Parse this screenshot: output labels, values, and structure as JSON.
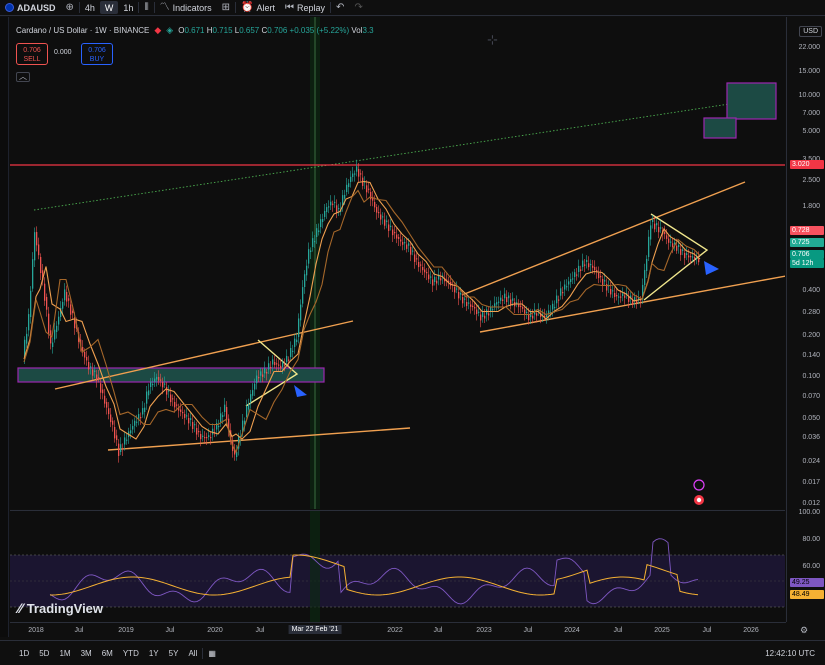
{
  "toolbar": {
    "symbol": "ADAUSD",
    "intervals": [
      "4h",
      "W",
      "1h"
    ],
    "active_interval": "W",
    "indicators_label": "Indicators",
    "alert_label": "Alert",
    "replay_label": "Replay"
  },
  "legend": {
    "title": "Cardano / US Dollar · 1W · BINANCE",
    "open_label": "O",
    "open": "0.671",
    "high_label": "H",
    "high": "0.715",
    "low_label": "L",
    "low": "0.657",
    "close_label": "C",
    "close": "0.706",
    "change": "+0.035 (+5.22%)",
    "vol_label": "Vol",
    "vol": "3.3"
  },
  "trade": {
    "sell_price": "0.706",
    "sell_label": "SELL",
    "spread": "0.000",
    "buy_price": "0.706",
    "buy_label": "BUY"
  },
  "price_axis": {
    "currency": "USD",
    "ticks": [
      "22.000",
      "15.000",
      "10.000",
      "7.000",
      "5.000",
      "3.500",
      "2.500",
      "1.800",
      "1.200",
      "0.400",
      "0.280",
      "0.200",
      "0.140",
      "0.100",
      "0.070",
      "0.050",
      "0.036",
      "0.024",
      "0.017",
      "0.012"
    ],
    "tags": [
      {
        "text": "3.020",
        "color": "#f23645"
      },
      {
        "text": "0.728",
        "color": "#f7525f"
      },
      {
        "text": "0.725",
        "color": "#22ab94"
      },
      {
        "text": "0.706",
        "color": "#089981"
      },
      {
        "text": "5d 12h",
        "color": "#089981"
      }
    ]
  },
  "rsi_axis": {
    "ticks": [
      "100.00",
      "80.00",
      "60.00"
    ],
    "tags": [
      {
        "text": "49.25",
        "color": "#7e57c2"
      },
      {
        "text": "48.49",
        "color": "#f5b133"
      }
    ]
  },
  "time_axis": {
    "ticks": [
      "2018",
      "Jul",
      "2019",
      "Jul",
      "2020",
      "Jul",
      "2022",
      "Jul",
      "2023",
      "Jul",
      "2024",
      "Jul",
      "2025",
      "Jul",
      "2026"
    ],
    "cursor_label": "Mar 22 Feb '21"
  },
  "brand": "TradingView",
  "bottom": {
    "ranges": [
      "1D",
      "5D",
      "1M",
      "3M",
      "6M",
      "YTD",
      "1Y",
      "5Y",
      "All"
    ],
    "utc_time": "12:42:10 UTC"
  },
  "colors": {
    "up": "#26a69a",
    "down": "#ef5350",
    "trendline": "#f0a050",
    "triangle": "#f0e68c",
    "resistance": "#f23645",
    "zone_fill": "#1c4a44",
    "zone_border": "#9c27b0",
    "rsi": "#7e57c2",
    "rsi_ma": "#f5b133"
  },
  "icons": [
    "plus-icon",
    "bar-style-icon",
    "indicators-icon",
    "templates-icon",
    "alert-icon",
    "replay-icon",
    "undo-icon",
    "redo-icon",
    "crosshair-icon",
    "settings-icon",
    "calendar-icon"
  ]
}
